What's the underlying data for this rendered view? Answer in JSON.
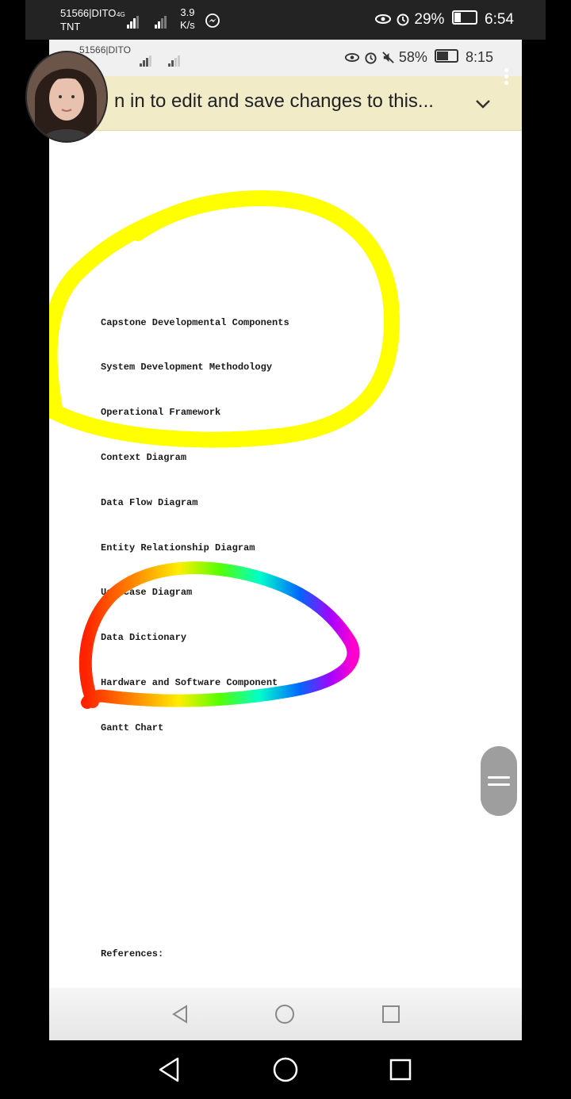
{
  "outer_status": {
    "carrier_line1": "51566|DITO",
    "carrier_line2": "TNT",
    "network_badge": "4G",
    "speed_value": "3.9",
    "speed_unit": "K/s",
    "messenger_icon": "messenger-icon",
    "battery": "29%",
    "time": "6:54"
  },
  "inner_status": {
    "carrier": "51566|DITO",
    "battery": "58%",
    "time": "8:15"
  },
  "banner": {
    "text": "n in to edit and save changes to this..."
  },
  "document": {
    "items": [
      "Capstone Developmental Components",
      "System Development Methodology",
      "Operational Framework",
      "Context Diagram",
      "Data Flow Diagram",
      "Entity Relationship Diagram",
      "Use Case Diagram",
      "Data Dictionary",
      "Hardware and Software Component",
      "Gantt Chart"
    ],
    "references": "References:"
  },
  "annotations": {
    "circle_1_color": "#ffff00",
    "circle_2_style": "rainbow-gradient"
  },
  "colors": {
    "banner_bg": "#f1ebc8",
    "status_bar": "#232323",
    "fab": "#9e9e9e"
  }
}
